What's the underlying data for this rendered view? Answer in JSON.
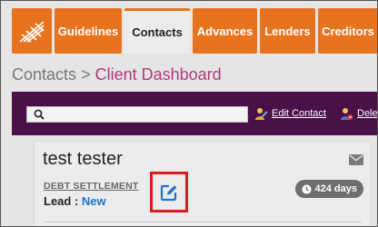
{
  "nav": {
    "tabs": [
      {
        "label": "Guidelines",
        "active": false
      },
      {
        "label": "Contacts",
        "active": true
      },
      {
        "label": "Advances",
        "active": false
      },
      {
        "label": "Lenders",
        "active": false
      },
      {
        "label": "Creditors",
        "active": false
      }
    ],
    "accent_color": "#e8731f"
  },
  "breadcrumb": {
    "root": "Contacts",
    "separator": ">",
    "current": "Client Dashboard"
  },
  "toolbar": {
    "search_placeholder": "",
    "edit_contact_label": "Edit Contact",
    "delete_label": "Dele",
    "background_color": "#4a1149"
  },
  "contact": {
    "name": "test tester",
    "department": "DEBT SETTLEMENT",
    "lead_label": "Lead :",
    "lead_value": "New",
    "days_badge": "424 days"
  },
  "icons": {
    "logo": "grid-logo-icon",
    "search": "search-icon",
    "edit_contact": "edit-contact-icon",
    "delete": "delete-contact-icon",
    "mail": "envelope-icon",
    "clock": "clock-icon",
    "edit": "pencil-square-icon"
  }
}
